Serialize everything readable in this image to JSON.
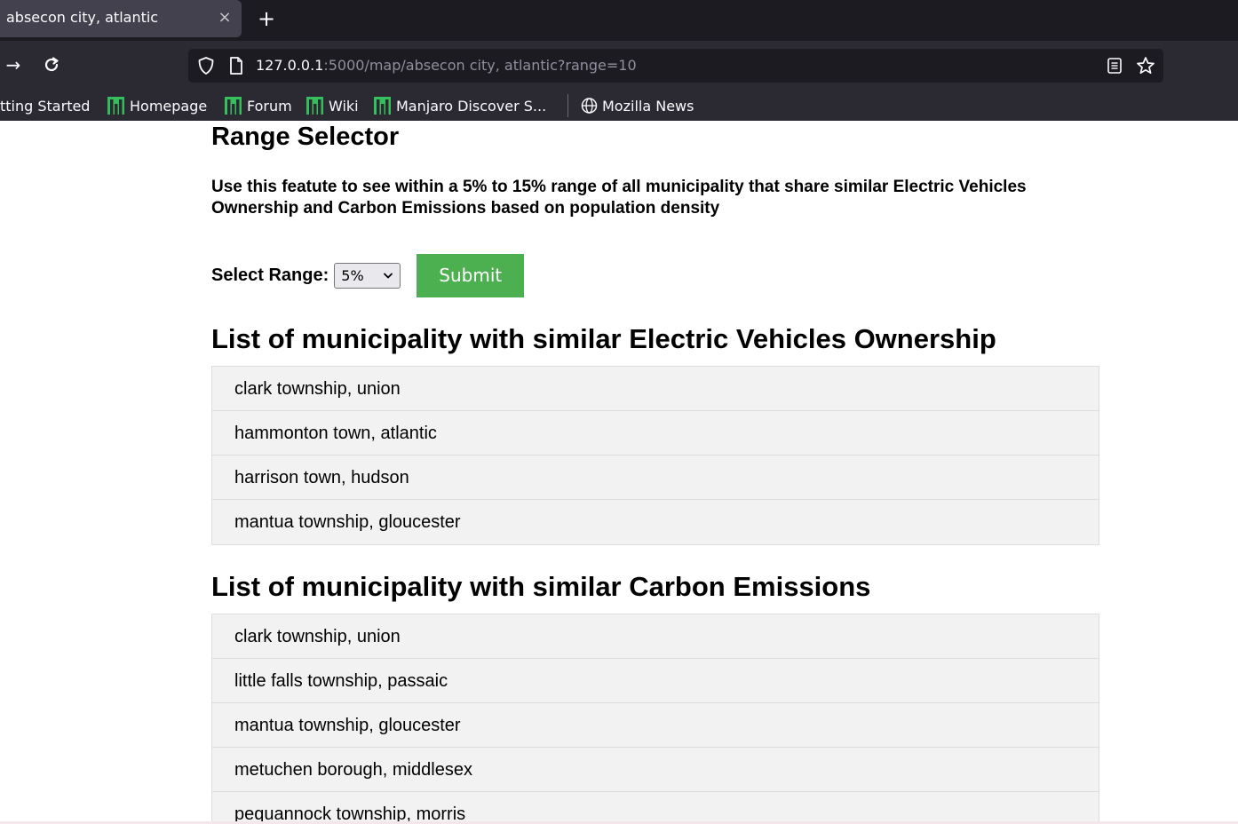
{
  "browser": {
    "tab": {
      "title": "absecon city, atlantic",
      "close_icon": "×",
      "new_tab_icon": "+"
    },
    "nav": {
      "forward_icon": "→",
      "reload_icon": "↻"
    },
    "url": {
      "host": "127.0.0.1",
      "rest": ":5000/map/absecon city, atlantic?range=10"
    },
    "bookmarks": [
      {
        "label": "tting Started"
      },
      {
        "label": "Homepage"
      },
      {
        "label": "Forum"
      },
      {
        "label": "Wiki"
      },
      {
        "label": "Manjaro Discover S..."
      },
      {
        "label": "Mozilla News"
      }
    ]
  },
  "page": {
    "title": "Range Selector",
    "description": "Use this featute to see within a 5% to 15% range of all municipality that share similar Electric Vehicles Ownership and Carbon Emissions based on population density",
    "range_label": "Select Range:",
    "range_selected": "5%",
    "submit_label": "Submit",
    "submit_color": "#4caf50",
    "ev_title": "List of municipality with similar Electric Vehicles Ownership",
    "ev_list": [
      "clark township, union",
      "hammonton town, atlantic",
      "harrison town, hudson",
      "mantua township, gloucester"
    ],
    "carbon_title": "List of municipality with similar Carbon Emissions",
    "carbon_list": [
      "clark township, union",
      "little falls township, passaic",
      "mantua township, gloucester",
      "metuchen borough, middlesex",
      "pequannock township, morris"
    ]
  }
}
